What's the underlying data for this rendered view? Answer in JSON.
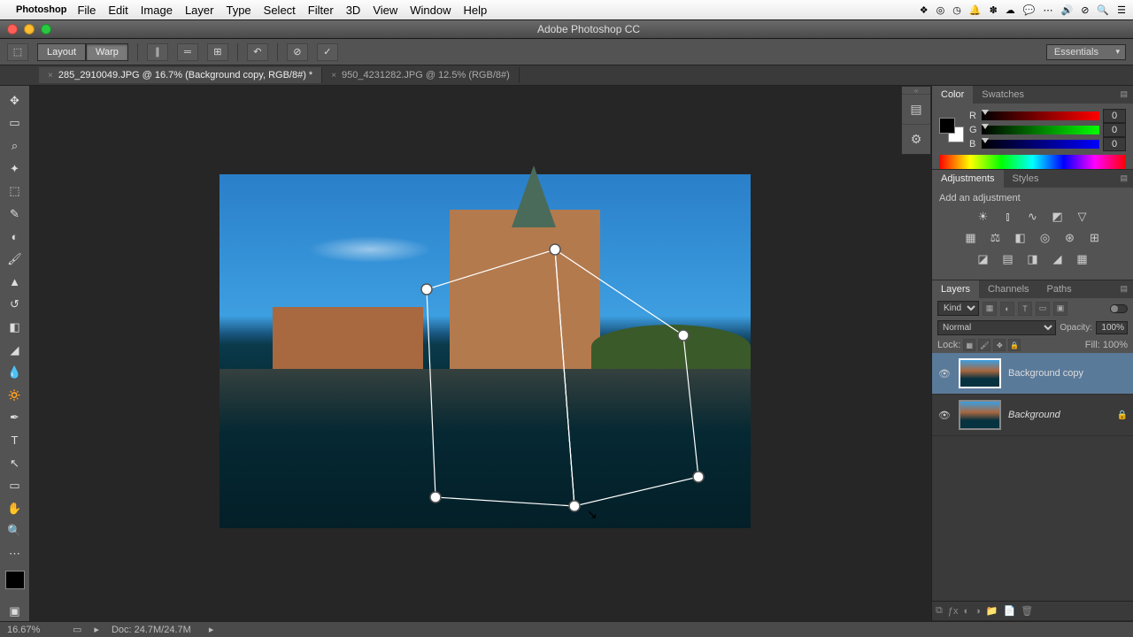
{
  "menubar": {
    "app": "Photoshop",
    "items": [
      "File",
      "Edit",
      "Image",
      "Layer",
      "Type",
      "Select",
      "Filter",
      "3D",
      "View",
      "Window",
      "Help"
    ]
  },
  "window": {
    "title": "Adobe Photoshop CC"
  },
  "options": {
    "layout": "Layout",
    "warp": "Warp",
    "workspace": "Essentials"
  },
  "tabs": [
    {
      "label": "285_2910049.JPG @ 16.7% (Background copy, RGB/8#) *",
      "active": true
    },
    {
      "label": "950_4231282.JPG @ 12.5% (RGB/8#)",
      "active": false
    }
  ],
  "color": {
    "tab1": "Color",
    "tab2": "Swatches",
    "r_label": "R",
    "r_val": "0",
    "g_label": "G",
    "g_val": "0",
    "b_label": "B",
    "b_val": "0"
  },
  "adjustments": {
    "tab1": "Adjustments",
    "tab2": "Styles",
    "hint": "Add an adjustment"
  },
  "layers_panel": {
    "tab1": "Layers",
    "tab2": "Channels",
    "tab3": "Paths",
    "kind": "Kind",
    "blend": "Normal",
    "opacity_lbl": "Opacity:",
    "opacity_val": "100%",
    "lock_lbl": "Lock:",
    "fill_lbl": "Fill:",
    "fill_val": "100%",
    "layers": [
      {
        "name": "Background copy",
        "selected": true,
        "bg": false,
        "locked": false
      },
      {
        "name": "Background",
        "selected": false,
        "bg": true,
        "locked": true
      }
    ]
  },
  "status": {
    "zoom": "16.67%",
    "doc": "Doc: 24.7M/24.7M"
  }
}
